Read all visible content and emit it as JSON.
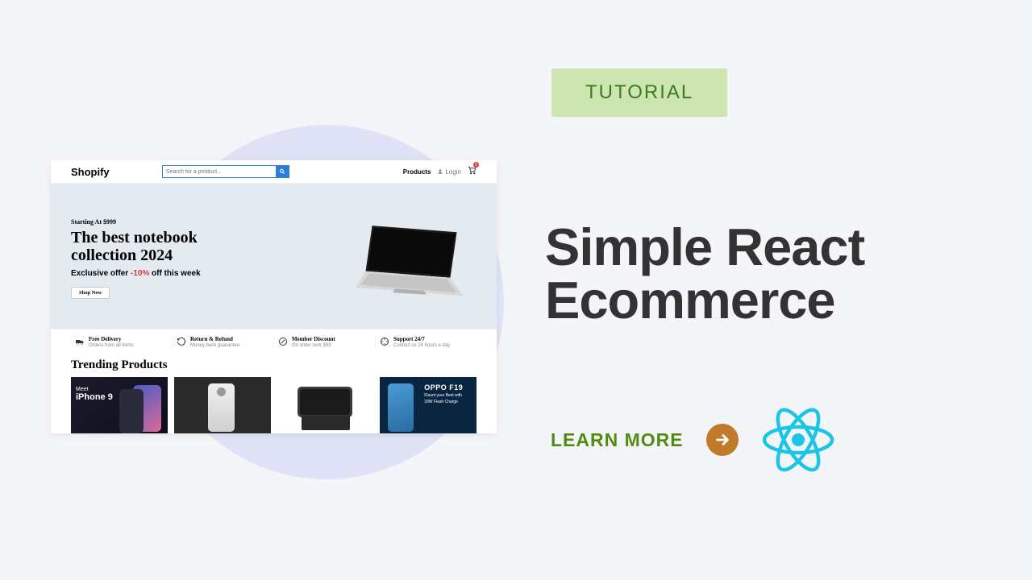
{
  "badge": {
    "label": "TUTORIAL"
  },
  "main": {
    "title_line1": "Simple React",
    "title_line2": "Ecommerce"
  },
  "cta": {
    "label": "LEARN MORE"
  },
  "preview": {
    "brand": "Shopify",
    "search_placeholder": "Search for a product...",
    "nav": {
      "products": "Products",
      "login": "Login",
      "cart_count": "0"
    },
    "hero": {
      "pre": "Starting At $999",
      "title_line1": "The best notebook",
      "title_line2": "collection 2024",
      "sub_before": "Exclusive offer ",
      "offer": "-10%",
      "sub_after": " off this week",
      "button": "Shop Now"
    },
    "features": [
      {
        "title": "Free Delivery",
        "desc": "Orders from all items"
      },
      {
        "title": "Return & Refund",
        "desc": "Money back guarantee"
      },
      {
        "title": "Member Discount",
        "desc": "On order over $99"
      },
      {
        "title": "Support 24/7",
        "desc": "Contact us 24 hours a day"
      }
    ],
    "trending": {
      "title": "Trending Products"
    },
    "products": {
      "p1_meet": "Meet",
      "p1_name": "iPhone 9",
      "p4_brand": "OPPO F19",
      "p4_line": "Flaunt your Best with",
      "p4_line2": "33W Flash Charge"
    }
  }
}
